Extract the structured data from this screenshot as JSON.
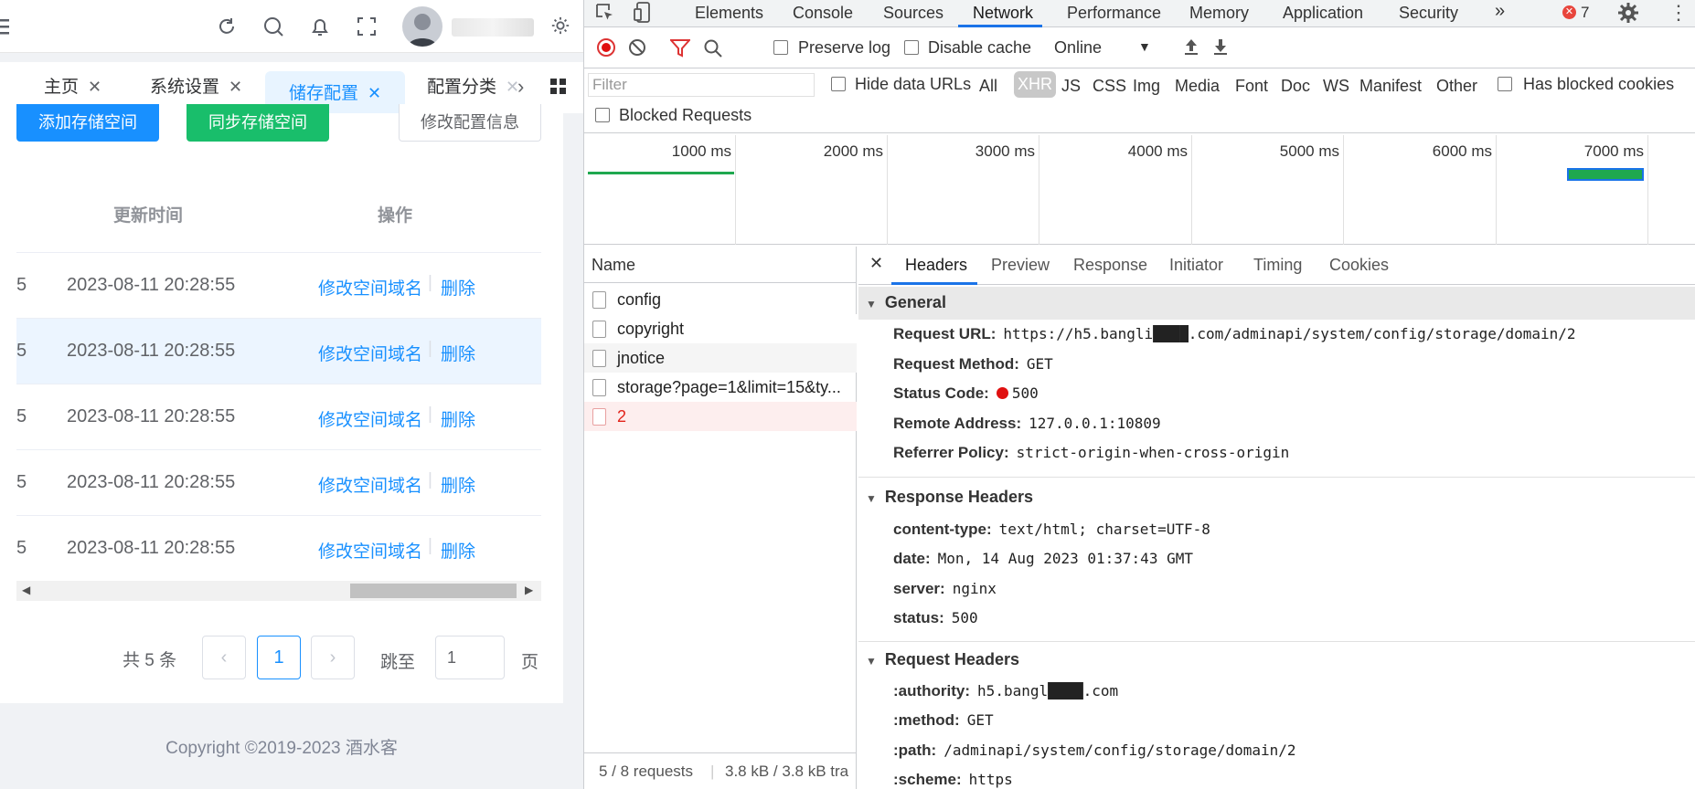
{
  "left_app": {
    "tabs": [
      {
        "label": "主页"
      },
      {
        "label": "系统设置"
      },
      {
        "label": "储存配置"
      },
      {
        "label": "配置分类"
      }
    ],
    "buttons": {
      "add_storage": "添加存储空间",
      "sync_storage": "同步存储空间",
      "edit_config": "修改配置信息"
    },
    "table": {
      "headers": [
        "更新时间",
        "操作"
      ],
      "rows": [
        {
          "num": "5",
          "time": "2023-08-11 20:28:55",
          "action": "修改空间域名",
          "sep": "|",
          "delete": "删除"
        },
        {
          "num": "5",
          "time": "2023-08-11 20:28:55",
          "action": "修改空间域名",
          "sep": "|",
          "delete": "删除"
        },
        {
          "num": "5",
          "time": "2023-08-11 20:28:55",
          "action": "修改空间域名",
          "sep": "|",
          "delete": "删除"
        },
        {
          "num": "5",
          "time": "2023-08-11 20:28:55",
          "action": "修改空间域名",
          "sep": "|",
          "delete": "删除"
        },
        {
          "num": "5",
          "time": "2023-08-11 20:28:55",
          "action": "修改空间域名",
          "sep": "|",
          "delete": "删除"
        }
      ]
    },
    "pagination": {
      "total": "共 5 条",
      "current_page": "1",
      "jump_label": "跳至",
      "jump_value": "1",
      "page_suffix": "页"
    },
    "footer": "Copyright ©2019-2023 酒水客"
  },
  "devtools": {
    "tabs": [
      "Elements",
      "Console",
      "Sources",
      "Network",
      "Performance",
      "Memory",
      "Application",
      "Security"
    ],
    "selected_tab": "Network",
    "error_count": "7",
    "toolbar": {
      "preserve_log": "Preserve log",
      "disable_cache": "Disable cache",
      "throttling": "Online"
    },
    "filter": {
      "placeholder": "Filter",
      "hide_data_urls": "Hide data URLs",
      "types": [
        "All",
        "XHR",
        "JS",
        "CSS",
        "Img",
        "Media",
        "Font",
        "Doc",
        "WS",
        "Manifest",
        "Other"
      ],
      "selected_type": "XHR",
      "has_blocked_cookies": "Has blocked cookies",
      "blocked_requests": "Blocked Requests"
    },
    "timeline": [
      "1000 ms",
      "2000 ms",
      "3000 ms",
      "4000 ms",
      "5000 ms",
      "6000 ms",
      "7000 ms"
    ],
    "request_list": {
      "header": "Name",
      "items": [
        {
          "name": "config",
          "error": false
        },
        {
          "name": "copyright",
          "error": false
        },
        {
          "name": "jnotice",
          "error": false
        },
        {
          "name": "storage?page=1&limit=15&ty...",
          "error": false
        },
        {
          "name": "2",
          "error": true
        }
      ],
      "summary_requests": "5 / 8 requests",
      "summary_size": "3.8 kB / 3.8 kB tra"
    },
    "detail_tabs": [
      "Headers",
      "Preview",
      "Response",
      "Initiator",
      "Timing",
      "Cookies"
    ],
    "general": {
      "title": "General",
      "request_url_key": "Request URL:",
      "request_url": "https://h5.bangli████.com/adminapi/system/config/storage/domain/2",
      "request_method_key": "Request Method:",
      "request_method": "GET",
      "status_code_key": "Status Code:",
      "status_code": "500",
      "remote_address_key": "Remote Address:",
      "remote_address": "127.0.0.1:10809",
      "referrer_policy_key": "Referrer Policy:",
      "referrer_policy": "strict-origin-when-cross-origin"
    },
    "response_headers": {
      "title": "Response Headers",
      "items": [
        {
          "k": "content-type:",
          "v": "text/html; charset=UTF-8"
        },
        {
          "k": "date:",
          "v": "Mon, 14 Aug 2023 01:37:43 GMT"
        },
        {
          "k": "server:",
          "v": "nginx"
        },
        {
          "k": "status:",
          "v": "500"
        }
      ]
    },
    "request_headers": {
      "title": "Request Headers",
      "items": [
        {
          "k": ":authority:",
          "v": "h5.bangl████.com"
        },
        {
          "k": ":method:",
          "v": "GET"
        },
        {
          "k": ":path:",
          "v": "/adminapi/system/config/storage/domain/2"
        },
        {
          "k": ":scheme:",
          "v": "https"
        }
      ]
    }
  }
}
